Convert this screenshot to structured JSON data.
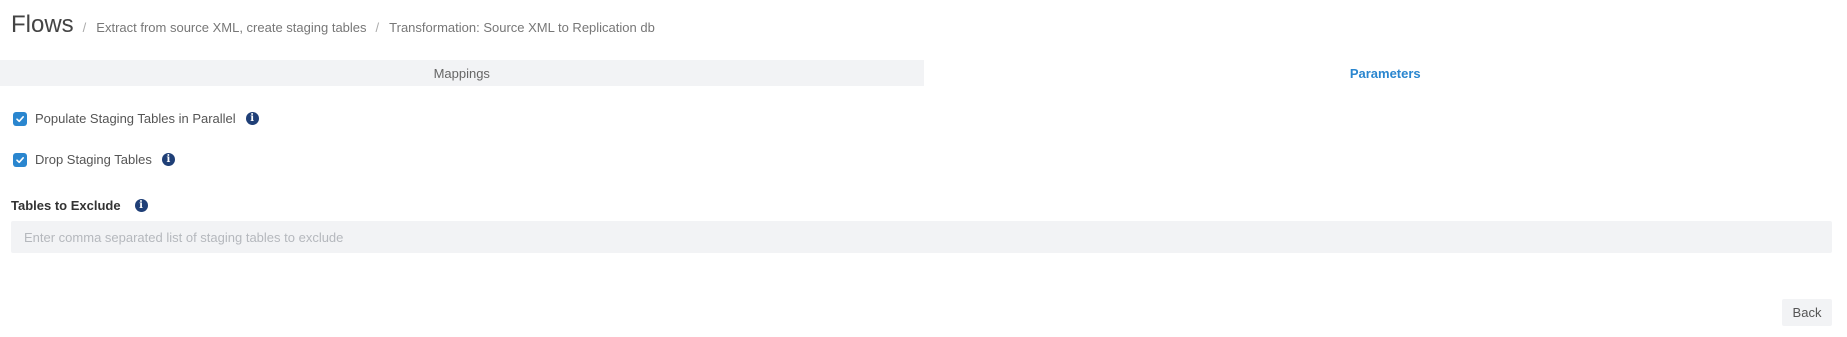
{
  "header": {
    "title": "Flows",
    "separator": "/",
    "breadcrumbs": [
      "Extract from source XML, create staging tables",
      "Transformation: Source XML to Replication db"
    ]
  },
  "tabs": [
    {
      "label": "Mappings",
      "active": false
    },
    {
      "label": "Parameters",
      "active": true
    }
  ],
  "parameters": {
    "populate_parallel": {
      "label": "Populate Staging Tables in Parallel",
      "checked": true,
      "info_icon": "info-icon"
    },
    "drop_staging": {
      "label": "Drop Staging Tables",
      "checked": true,
      "info_icon": "info-icon"
    },
    "tables_to_exclude": {
      "label": "Tables to Exclude",
      "value": "",
      "placeholder": "Enter comma separated list of staging tables to exclude",
      "info_icon": "info-icon"
    }
  },
  "actions": {
    "back_label": "Back"
  },
  "colors": {
    "accent": "#2a86cf",
    "info_icon": "#1f3f77",
    "tab_inactive_bg": "#f2f3f5"
  }
}
